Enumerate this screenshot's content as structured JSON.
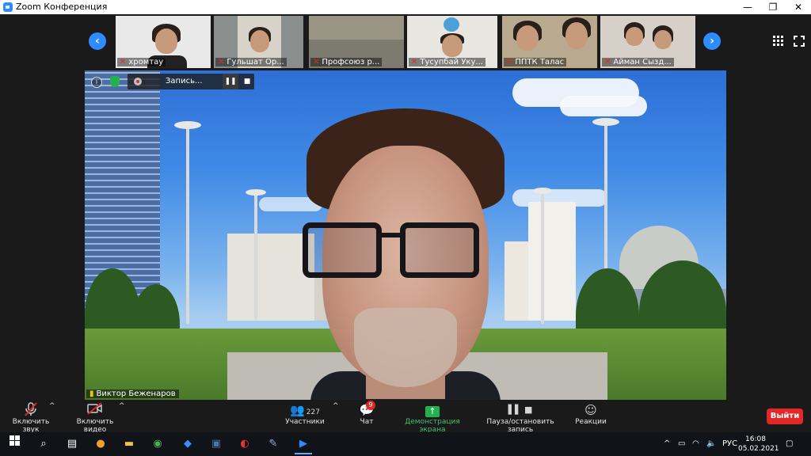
{
  "window": {
    "title": "Zoom Конференция",
    "controls": [
      "—",
      "❐",
      "✕"
    ]
  },
  "strip": {
    "participants": [
      {
        "name": "хромтау"
      },
      {
        "name": "Гульшат Ор..."
      },
      {
        "name": "Профсоюз р..."
      },
      {
        "name": "Тусупбай Уку..."
      },
      {
        "name": "ППТК Талас"
      },
      {
        "name": "Айман Сызд..."
      }
    ]
  },
  "main_video": {
    "speaker": "Виктор Беженаров",
    "recording_label": "Запись..."
  },
  "toolbar": {
    "unmute_label": "Включить звук",
    "video_label": "Включить видео",
    "participants_label": "Участники",
    "participants_count": "227",
    "chat_label": "Чат",
    "chat_badge": "9",
    "share_label": "Демонстрация экрана",
    "record_label": "Пауза/остановить запись",
    "reactions_label": "Реакции",
    "exit_label": "Выйти"
  },
  "taskbar": {
    "lang": "РУС",
    "time": "16:08",
    "date": "05.02.2021"
  },
  "colors": {
    "accent": "#2d8cff",
    "danger": "#e02828",
    "share": "#22b14c"
  }
}
